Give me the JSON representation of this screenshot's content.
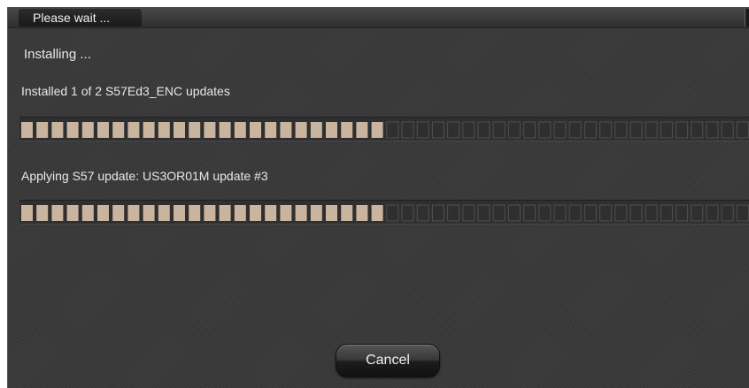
{
  "dialog": {
    "title": "Please wait ..."
  },
  "status": {
    "heading": "Installing ..."
  },
  "progress": [
    {
      "message": "Installed 1 of 2 S57Ed3_ENC updates",
      "value": 0.5
    },
    {
      "message": "Applying S57 update: US3OR01M update #3",
      "value": 0.5
    }
  ],
  "buttons": {
    "cancel_label": "Cancel"
  },
  "colors": {
    "filled_segment": "#c8b49f",
    "empty_segment_border": "#4f4f4f",
    "dialog_background": "#3a3a3a",
    "text": "#e8e8e8"
  }
}
